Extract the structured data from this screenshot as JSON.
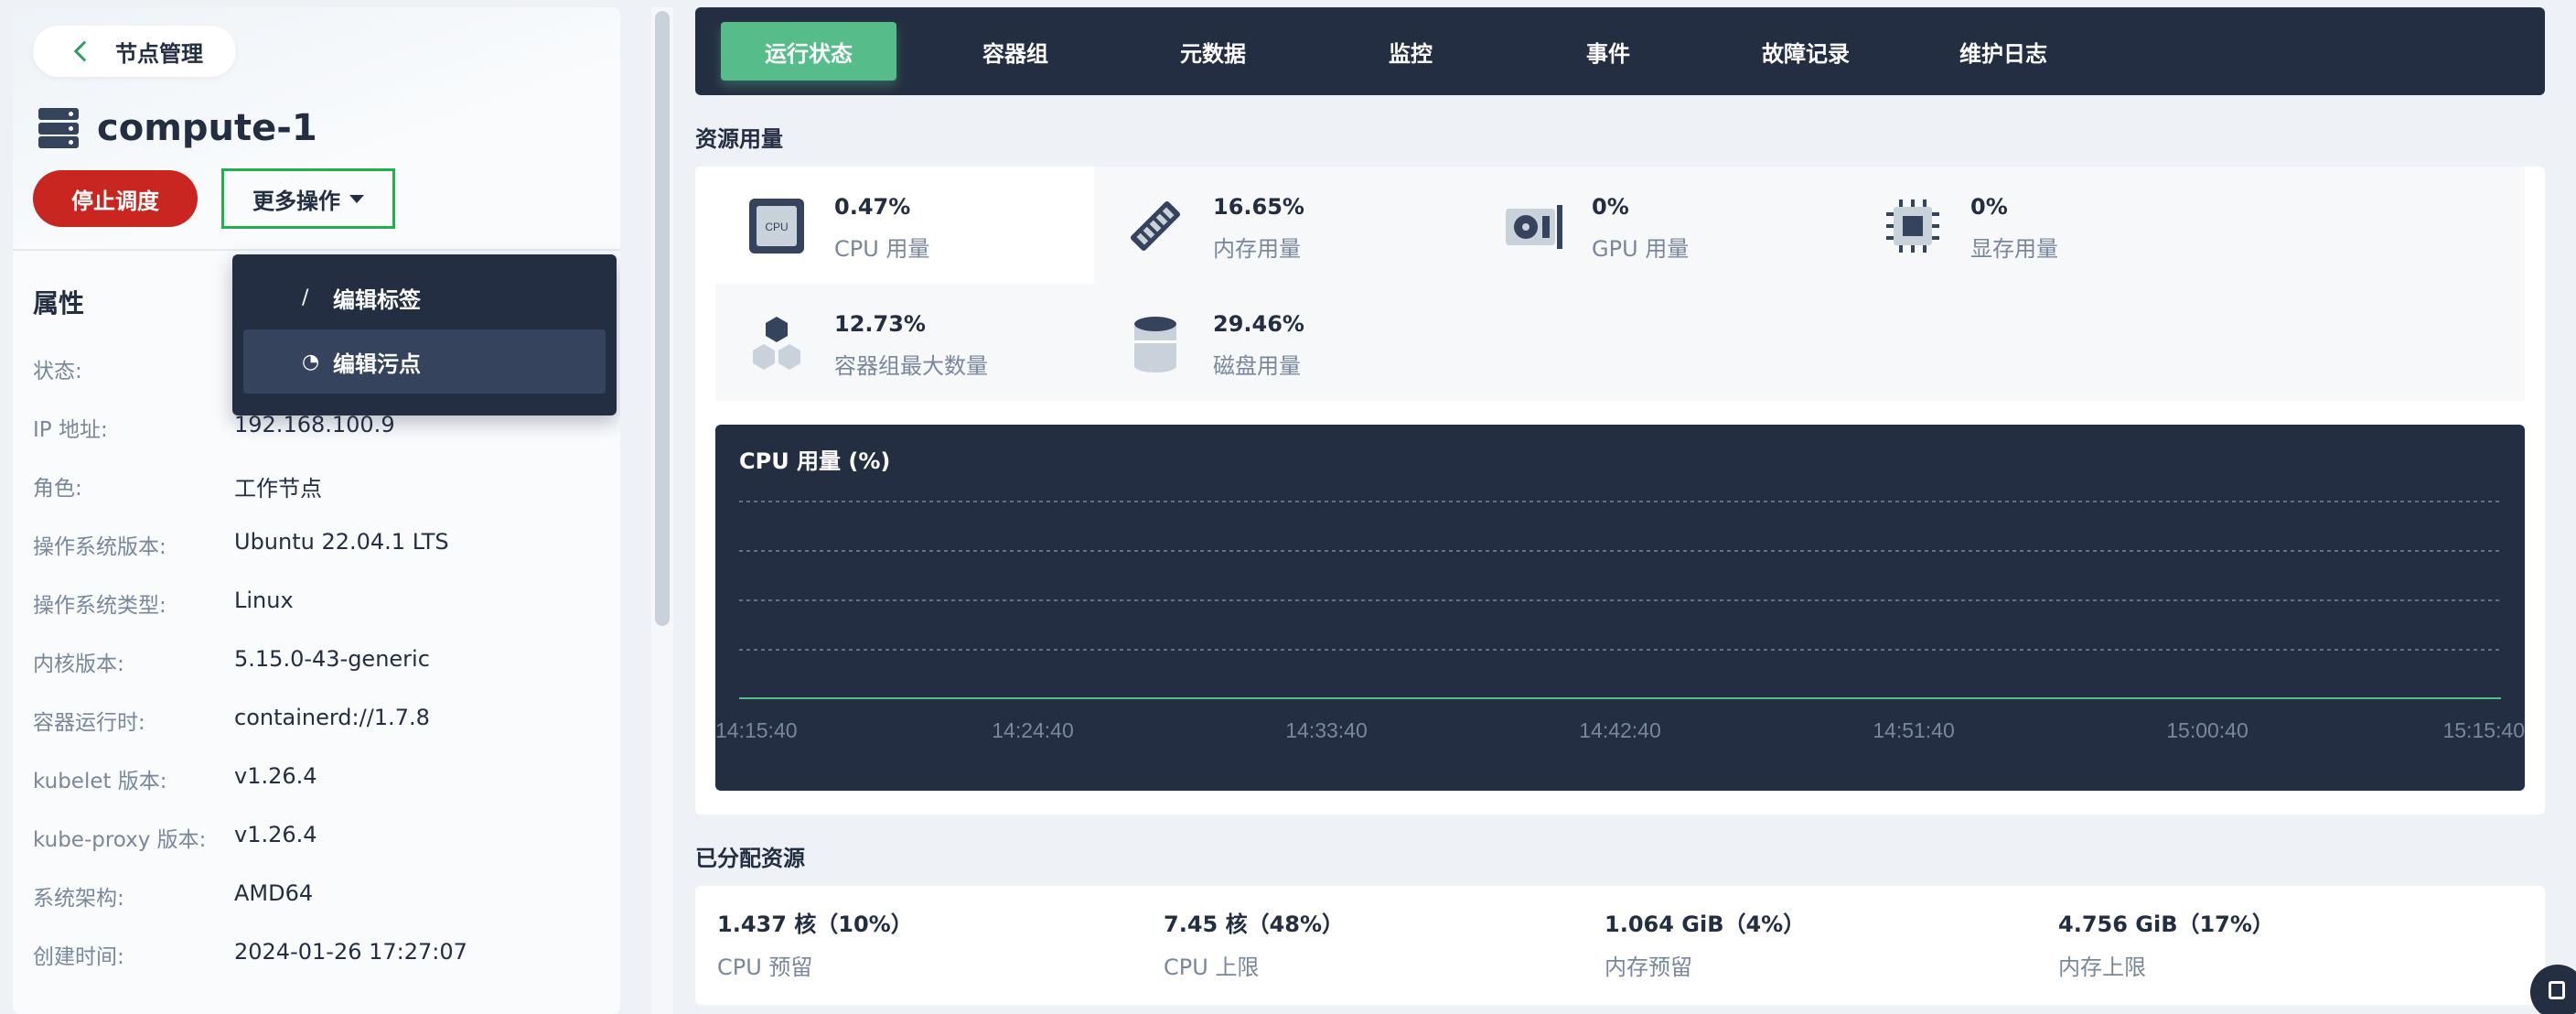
{
  "nav": {
    "back_label": "节点管理"
  },
  "node": {
    "name": "compute-1",
    "stop_label": "停止调度",
    "more_label": "更多操作"
  },
  "menu": {
    "items": [
      {
        "label": "编辑标签",
        "icon": "pencil-icon"
      },
      {
        "label": "编辑污点",
        "icon": "taint-icon"
      }
    ]
  },
  "props": {
    "title": "属性",
    "rows": [
      {
        "k": "状态:",
        "v": ""
      },
      {
        "k": "IP 地址:",
        "v": "192.168.100.9"
      },
      {
        "k": "角色:",
        "v": "工作节点"
      },
      {
        "k": "操作系统版本:",
        "v": "Ubuntu 22.04.1 LTS"
      },
      {
        "k": "操作系统类型:",
        "v": "Linux"
      },
      {
        "k": "内核版本:",
        "v": "5.15.0-43-generic"
      },
      {
        "k": "容器运行时:",
        "v": "containerd://1.7.8"
      },
      {
        "k": "kubelet 版本:",
        "v": "v1.26.4"
      },
      {
        "k": "kube-proxy 版本:",
        "v": "v1.26.4"
      },
      {
        "k": "系统架构:",
        "v": "AMD64"
      },
      {
        "k": "创建时间:",
        "v": "2024-01-26 17:27:07"
      }
    ]
  },
  "tabs": [
    "运行状态",
    "容器组",
    "元数据",
    "监控",
    "事件",
    "故障记录",
    "维护日志"
  ],
  "usage": {
    "title": "资源用量",
    "metrics": [
      {
        "value": "0.47%",
        "label": "CPU 用量",
        "icon": "cpu-icon"
      },
      {
        "value": "16.65%",
        "label": "内存用量",
        "icon": "memory-icon"
      },
      {
        "value": "0%",
        "label": "GPU 用量",
        "icon": "gpu-icon"
      },
      {
        "value": "0%",
        "label": "显存用量",
        "icon": "chip-icon"
      },
      {
        "value": "12.73%",
        "label": "容器组最大数量",
        "icon": "pods-icon"
      },
      {
        "value": "29.46%",
        "label": "磁盘用量",
        "icon": "disk-icon"
      }
    ]
  },
  "chart_data": {
    "type": "line",
    "title": "CPU 用量 (%)",
    "x": [
      "14:15:40",
      "14:24:40",
      "14:33:40",
      "14:42:40",
      "14:51:40",
      "15:00:40",
      "15:15:40"
    ],
    "series": [
      {
        "values": [
          0.47,
          0.47,
          0.47,
          0.47,
          0.47,
          0.47,
          0.47
        ]
      }
    ],
    "grid": true,
    "colors": {
      "line": "#55bc8a",
      "grid": "#79879c",
      "background": "#242e42"
    }
  },
  "allocated": {
    "title": "已分配资源",
    "items": [
      {
        "value": "1.437 核（10%）",
        "label": "CPU 预留"
      },
      {
        "value": "7.45 核（48%）",
        "label": "CPU 上限"
      },
      {
        "value": "1.064 GiB（4%）",
        "label": "内存预留"
      },
      {
        "value": "4.756 GiB（17%）",
        "label": "内存上限"
      }
    ]
  },
  "colors": {
    "accent": "#55bc8a",
    "danger": "#ca2621",
    "dark": "#242e42"
  }
}
